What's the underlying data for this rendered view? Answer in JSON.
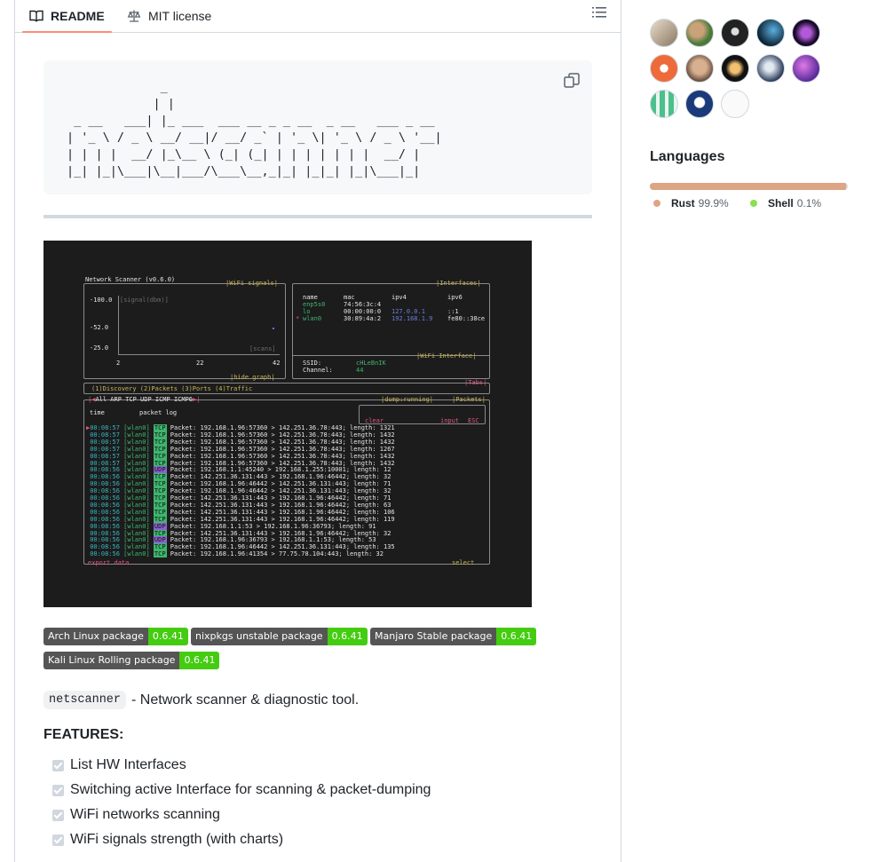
{
  "tabs": {
    "readme": "README",
    "license": "MIT license"
  },
  "ascii_art": "             _\n            | |\n _ __   ___| |_ ___  ___ __ _ _ __  _ __   ___ _ __\n| '_ \\ / _ \\ __/ __|/ __/ _` | '_ \\| '_ \\ / _ \\ '__|\n| | | |  __/ |_\\__ \\ (_| (_| | | | | | | |  __/ |\n|_| |_|\\___|\\__|___/\\___\\__,_|_| |_|_| |_|\\___|_|",
  "terminal": {
    "title": "Network Scanner (v0.6.0)",
    "wifi_signals": "|WiFi signals|",
    "y_top": "-100.0",
    "y_label": "[signal(dbm)]",
    "y_mid": "-52.0",
    "y_low": "-25.0",
    "x_axis_label": "[scans]",
    "x_ticks": [
      "2",
      "22",
      "42"
    ],
    "hide_graph": "|hide graph|",
    "interfaces_title": "|Interfaces|",
    "iface_headers": [
      "name",
      "mac",
      "ipv4",
      "ipv6"
    ],
    "iface_rows": [
      {
        "name": "enp5s0",
        "mac": "74:56:3c:4",
        "ipv4": "",
        "ipv6": ""
      },
      {
        "name": "lo",
        "mac": "00:00:00:0",
        "ipv4": "127.0.0.1",
        "ipv6": "::1"
      },
      {
        "name": "wlan0",
        "mac": "30:89:4a:2",
        "ipv4": "192.168.1.9",
        "ipv6": "fe80::38ce"
      }
    ],
    "wifi_interface_title": "|WiFi Interface|",
    "ssid_label": "SSID:",
    "ssid_value": "cHLeBnIK",
    "channel_label": "Channel:",
    "channel_value": "44",
    "tabs_line": "(1)Discovery (2)Packets (3)Ports (4)Traffic",
    "tabs_title": "|Tabs|",
    "filter_line": "All ARP TCP UDP ICMP ICMP6",
    "dump_status": "|dump:running|",
    "packets_title": "|Packets|",
    "col_time": "time",
    "col_log": "packet log",
    "clear": "clear",
    "input": "input",
    "esc": "ESC",
    "packets": [
      {
        "time": "00:08:57",
        "iface": "[wlan0]",
        "proto": "TCP",
        "text": "Packet: 192.168.1.96:57360 > 142.251.36.78:443; length: 1321"
      },
      {
        "time": "00:08:57",
        "iface": "[wlan0]",
        "proto": "TCP",
        "text": "Packet: 192.168.1.96:57360 > 142.251.36.78:443; length: 1432"
      },
      {
        "time": "00:08:57",
        "iface": "[wlan0]",
        "proto": "TCP",
        "text": "Packet: 192.168.1.96:57360 > 142.251.36.78:443; length: 1432"
      },
      {
        "time": "00:08:57",
        "iface": "[wlan0]",
        "proto": "TCP",
        "text": "Packet: 192.168.1.96:57360 > 142.251.36.78:443; length: 1267"
      },
      {
        "time": "00:08:57",
        "iface": "[wlan0]",
        "proto": "TCP",
        "text": "Packet: 192.168.1.96:57360 > 142.251.36.78:443; length: 1432"
      },
      {
        "time": "00:08:57",
        "iface": "[wlan0]",
        "proto": "TCP",
        "text": "Packet: 192.168.1.96:57360 > 142.251.36.78:443; length: 1432"
      },
      {
        "time": "00:08:56",
        "iface": "[wlan0]",
        "proto": "UDP",
        "text": "Packet: 192.168.1.1:45240 > 192.168.1.255:10001; length: 12"
      },
      {
        "time": "00:08:56",
        "iface": "[wlan0]",
        "proto": "TCP",
        "text": "Packet: 142.251.36.131:443 > 192.168.1.96:46442; length: 32"
      },
      {
        "time": "00:08:56",
        "iface": "[wlan0]",
        "proto": "TCP",
        "text": "Packet: 192.168.1.96:46442 > 142.251.36.131:443; length: 71"
      },
      {
        "time": "00:08:56",
        "iface": "[wlan0]",
        "proto": "TCP",
        "text": "Packet: 192.168.1.96:46442 > 142.251.36.131:443; length: 32"
      },
      {
        "time": "00:08:56",
        "iface": "[wlan0]",
        "proto": "TCP",
        "text": "Packet: 142.251.36.131:443 > 192.168.1.96:46442; length: 71"
      },
      {
        "time": "00:08:56",
        "iface": "[wlan0]",
        "proto": "TCP",
        "text": "Packet: 142.251.36.131:443 > 192.168.1.96:46442; length: 63"
      },
      {
        "time": "00:08:56",
        "iface": "[wlan0]",
        "proto": "TCP",
        "text": "Packet: 142.251.36.131:443 > 192.168.1.96:46442; length: 106"
      },
      {
        "time": "00:08:56",
        "iface": "[wlan0]",
        "proto": "TCP",
        "text": "Packet: 142.251.36.131:443 > 192.168.1.96:46442; length: 119"
      },
      {
        "time": "00:08:56",
        "iface": "[wlan0]",
        "proto": "UDP",
        "text": "Packet: 192.168.1.1:53 > 192.168.1.96:36793; length: 91"
      },
      {
        "time": "00:08:56",
        "iface": "[wlan0]",
        "proto": "TCP",
        "text": "Packet: 142.251.36.131:443 > 192.168.1.96:46442; length: 32"
      },
      {
        "time": "00:08:56",
        "iface": "[wlan0]",
        "proto": "UDP",
        "text": "Packet: 192.168.1.96:36793 > 192.168.1.1:53; length: 53"
      },
      {
        "time": "00:08:56",
        "iface": "[wlan0]",
        "proto": "TCP",
        "text": "Packet: 192.168.1.96:46442 > 142.251.36.131:443; length: 135"
      },
      {
        "time": "00:08:56",
        "iface": "[wlan0]",
        "proto": "TCP",
        "text": "Packet: 192.168.1.96:41354 > 77.75.78.104:443; length: 32"
      }
    ],
    "export_data": "export data",
    "select": "select"
  },
  "badges": [
    {
      "label": "Arch Linux package",
      "value": "0.6.41"
    },
    {
      "label": "nixpkgs unstable package",
      "value": "0.6.41"
    },
    {
      "label": "Manjaro Stable package",
      "value": "0.6.41"
    },
    {
      "label": "Kali Linux Rolling package",
      "value": "0.6.41"
    }
  ],
  "description": {
    "code": "netscanner",
    "text": "- Network scanner & diagnostic tool."
  },
  "features_title": "FEATURES:",
  "features": [
    "List HW Interfaces",
    "Switching active Interface for scanning & packet-dumping",
    "WiFi networks scanning",
    "WiFi signals strength (with charts)"
  ],
  "sidebar": {
    "languages_title": "Languages",
    "languages": [
      {
        "name": "Rust",
        "pct": "99.9%",
        "color": "#dea584",
        "fraction": 0.999
      },
      {
        "name": "Shell",
        "pct": "0.1%",
        "color": "#89e051",
        "fraction": 0.001
      }
    ]
  },
  "colors": {
    "tab_underline": "#fd8c73",
    "badge_left": "#555555",
    "badge_right": "#44cc11",
    "terminal_bg": "#1c1c1c"
  }
}
